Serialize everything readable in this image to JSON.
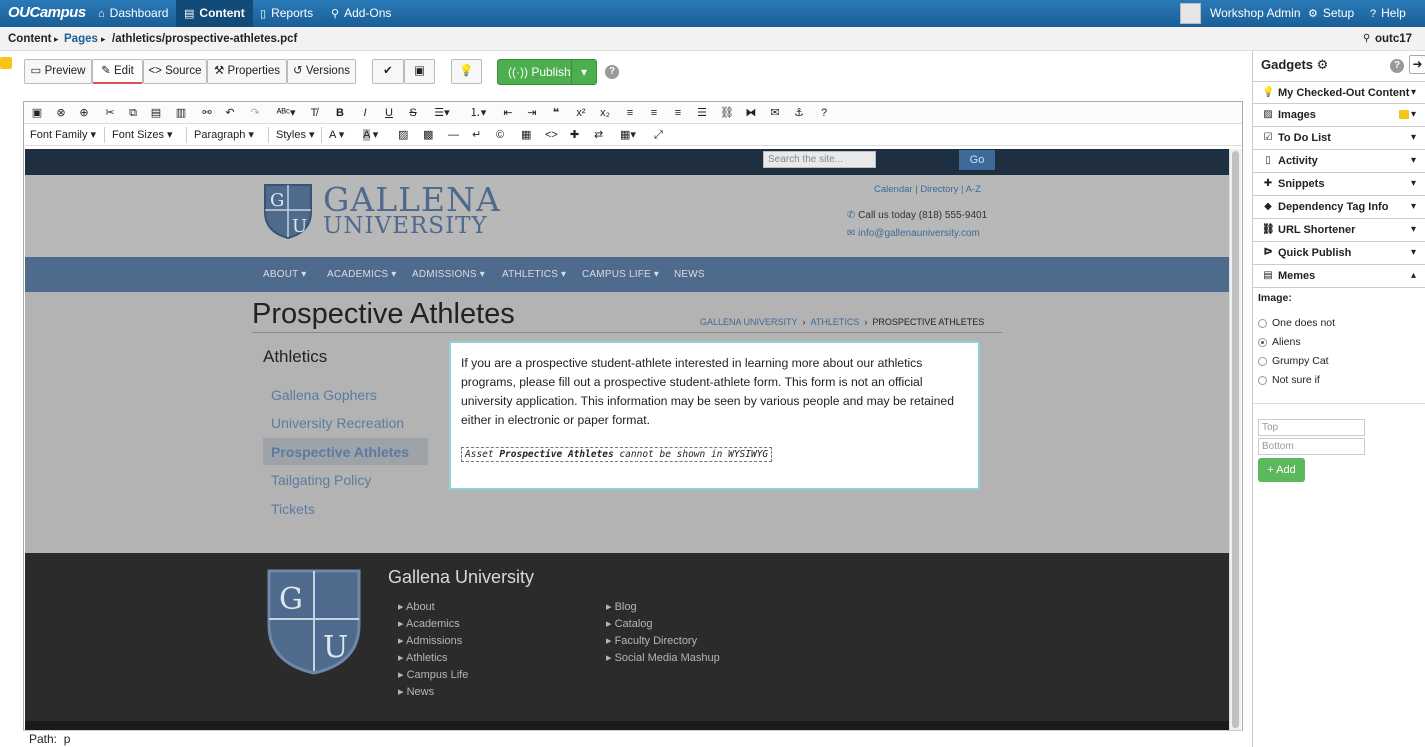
{
  "nav": {
    "logo": "OUCampus",
    "dashboard": "Dashboard",
    "content": "Content",
    "reports": "Reports",
    "addons": "Add-Ons",
    "user": "Workshop Admin",
    "setup": "Setup",
    "help": "Help"
  },
  "crumb": {
    "content": "Content",
    "pages": "Pages",
    "path": "/athletics/prospective-athletes.pcf",
    "server": "outc17"
  },
  "toolbar": {
    "preview": "Preview",
    "edit": "Edit",
    "source": "Source",
    "properties": "Properties",
    "versions": "Versions",
    "publish": "Publish"
  },
  "editor": {
    "font_family": "Font Family",
    "font_sizes": "Font Sizes",
    "paragraph": "Paragraph",
    "styles": "Styles"
  },
  "site": {
    "search_placeholder": "Search the site...",
    "go": "Go",
    "univ_line1": "GALLENA",
    "univ_line2": "UNIVERSITY",
    "util_calendar": "Calendar",
    "util_directory": "Directory",
    "util_az": "A-Z",
    "phone": "Call us today (818) 555-9401",
    "email": "info@gallenauniversity.com",
    "menu": [
      "ABOUT",
      "ACADEMICS",
      "ADMISSIONS",
      "ATHLETICS",
      "CAMPUS LIFE",
      "NEWS"
    ],
    "page_title": "Prospective Athletes",
    "breadcrumb": [
      "GALLENA UNIVERSITY",
      "ATHLETICS",
      "PROSPECTIVE ATHLETES"
    ],
    "side_title": "Athletics",
    "side_links": [
      "Gallena Gophers",
      "University Recreation",
      "Prospective Athletes",
      "Tailgating Policy",
      "Tickets"
    ],
    "body_text": "If you are a prospective student-athlete interested in learning more about our athletics programs, please fill out a prospective student-athlete form. This form is not an official university application. This information may be seen by various people and may be retained either in electronic or paper format.",
    "asset_prefix": "Asset ",
    "asset_name": "Prospective Athletes",
    "asset_suffix": " cannot be shown in WYSIWYG",
    "footer_title": "Gallena University",
    "footer_col1": [
      "About",
      "Academics",
      "Admissions",
      "Athletics",
      "Campus Life",
      "News"
    ],
    "footer_col2": [
      "Blog",
      "Catalog",
      "Faculty Directory",
      "Social Media Mashup"
    ]
  },
  "status": {
    "path": "Path:  p"
  },
  "gadgets": {
    "title": "Gadgets",
    "items": [
      "My Checked-Out Content",
      "Images",
      "To Do List",
      "Activity",
      "Snippets",
      "Dependency Tag Info",
      "URL Shortener",
      "Quick Publish",
      "Memes"
    ],
    "image_label": "Image:",
    "options": [
      "One does not",
      "Aliens",
      "Grumpy Cat",
      "Not sure if"
    ],
    "selected_option": "Aliens",
    "top_placeholder": "Top",
    "bottom_placeholder": "Bottom",
    "add": "+ Add"
  },
  "colors": {
    "nav_blue": "#1a5f97",
    "publish_green": "#4cae4c",
    "site_menu": "#4e6a8c",
    "footer_dark": "#2b2b2b"
  }
}
